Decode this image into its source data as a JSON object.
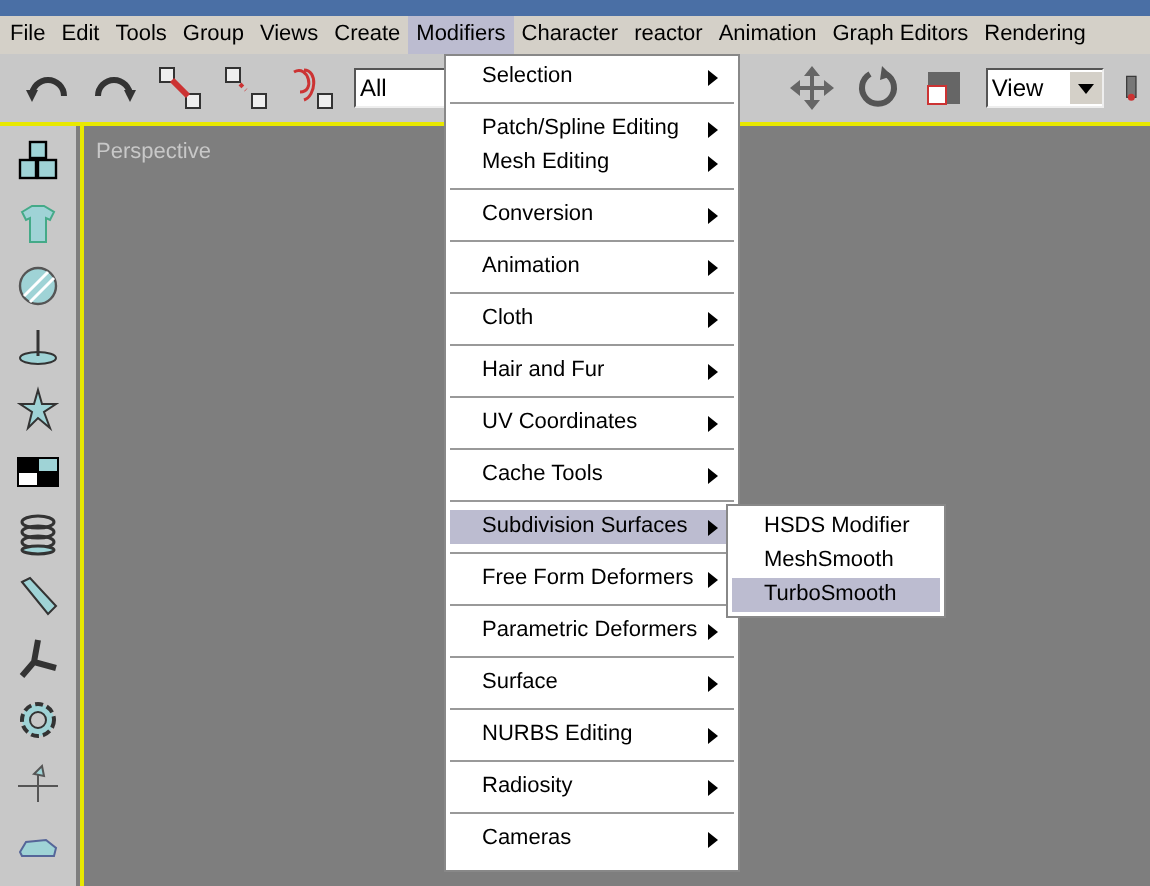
{
  "menubar": [
    {
      "label": "File",
      "selected": false
    },
    {
      "label": "Edit",
      "selected": false
    },
    {
      "label": "Tools",
      "selected": false
    },
    {
      "label": "Group",
      "selected": false
    },
    {
      "label": "Views",
      "selected": false
    },
    {
      "label": "Create",
      "selected": false
    },
    {
      "label": "Modifiers",
      "selected": true
    },
    {
      "label": "Character",
      "selected": false
    },
    {
      "label": "reactor",
      "selected": false
    },
    {
      "label": "Animation",
      "selected": false
    },
    {
      "label": "Graph Editors",
      "selected": false
    },
    {
      "label": "Rendering",
      "selected": false
    }
  ],
  "toolbar": {
    "selection_filter": "All",
    "reference_coordinate": "View"
  },
  "viewport": {
    "label": "Perspective"
  },
  "menu": {
    "groups": [
      [
        {
          "label": "Selection",
          "has_submenu": true,
          "selected": false
        }
      ],
      [
        {
          "label": "Patch/Spline Editing",
          "has_submenu": true,
          "selected": false
        },
        {
          "label": "Mesh Editing",
          "has_submenu": true,
          "selected": false
        }
      ],
      [
        {
          "label": "Conversion",
          "has_submenu": true,
          "selected": false
        }
      ],
      [
        {
          "label": "Animation",
          "has_submenu": true,
          "selected": false
        }
      ],
      [
        {
          "label": "Cloth",
          "has_submenu": true,
          "selected": false
        }
      ],
      [
        {
          "label": "Hair and Fur",
          "has_submenu": true,
          "selected": false
        }
      ],
      [
        {
          "label": "UV Coordinates",
          "has_submenu": true,
          "selected": false
        }
      ],
      [
        {
          "label": "Cache Tools",
          "has_submenu": true,
          "selected": false
        }
      ],
      [
        {
          "label": "Subdivision Surfaces",
          "has_submenu": true,
          "selected": true
        }
      ],
      [
        {
          "label": "Free Form Deformers",
          "has_submenu": true,
          "selected": false
        }
      ],
      [
        {
          "label": "Parametric Deformers",
          "has_submenu": true,
          "selected": false
        }
      ],
      [
        {
          "label": "Surface",
          "has_submenu": true,
          "selected": false
        }
      ],
      [
        {
          "label": "NURBS Editing",
          "has_submenu": true,
          "selected": false
        }
      ],
      [
        {
          "label": "Radiosity",
          "has_submenu": true,
          "selected": false
        }
      ],
      [
        {
          "label": "Cameras",
          "has_submenu": true,
          "selected": false
        }
      ]
    ]
  },
  "submenu": {
    "items": [
      {
        "label": "HSDS Modifier",
        "selected": false
      },
      {
        "label": "MeshSmooth",
        "selected": false
      },
      {
        "label": "TurboSmooth",
        "selected": true
      }
    ]
  }
}
